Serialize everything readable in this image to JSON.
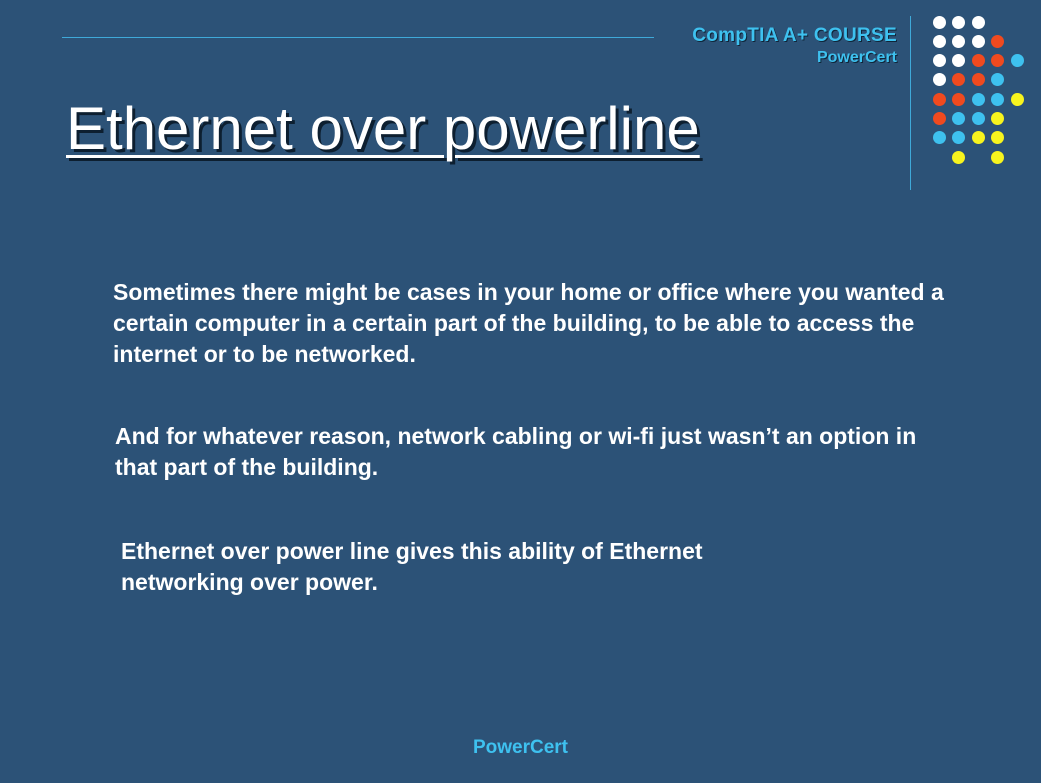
{
  "header": {
    "course_title": "CompTIA A+ COURSE",
    "brand": "PowerCert"
  },
  "slide": {
    "title": "Ethernet over powerline",
    "paragraphs": [
      "Sometimes there might be cases in your home or office where you wanted a certain computer in a certain part of the building, to be able to access the internet or to be networked.",
      "And for whatever reason, network cabling or wi-fi just wasn’t an option in that part of the building.",
      "Ethernet over power line gives this ability of Ethernet networking over power."
    ]
  },
  "footer": {
    "brand": "PowerCert"
  },
  "colors": {
    "background": "#2c5277",
    "accent_blue": "#3ec1ef",
    "dot_white": "#ffffff",
    "dot_red": "#f04a1f",
    "dot_blue": "#3ec1ef",
    "dot_yellow": "#f7f41e"
  },
  "decoration": {
    "dot_grid_rows": [
      [
        "white",
        "white",
        "white",
        "none",
        "none"
      ],
      [
        "white",
        "white",
        "white",
        "red",
        "none"
      ],
      [
        "white",
        "white",
        "red",
        "red",
        "blue"
      ],
      [
        "white",
        "red",
        "red",
        "blue",
        "none"
      ],
      [
        "red",
        "red",
        "blue",
        "blue",
        "yellow"
      ],
      [
        "red",
        "blue",
        "blue",
        "yellow",
        "none"
      ],
      [
        "blue",
        "blue",
        "yellow",
        "yellow",
        "none"
      ],
      [
        "none",
        "yellow",
        "none",
        "yellow",
        "none"
      ]
    ]
  }
}
